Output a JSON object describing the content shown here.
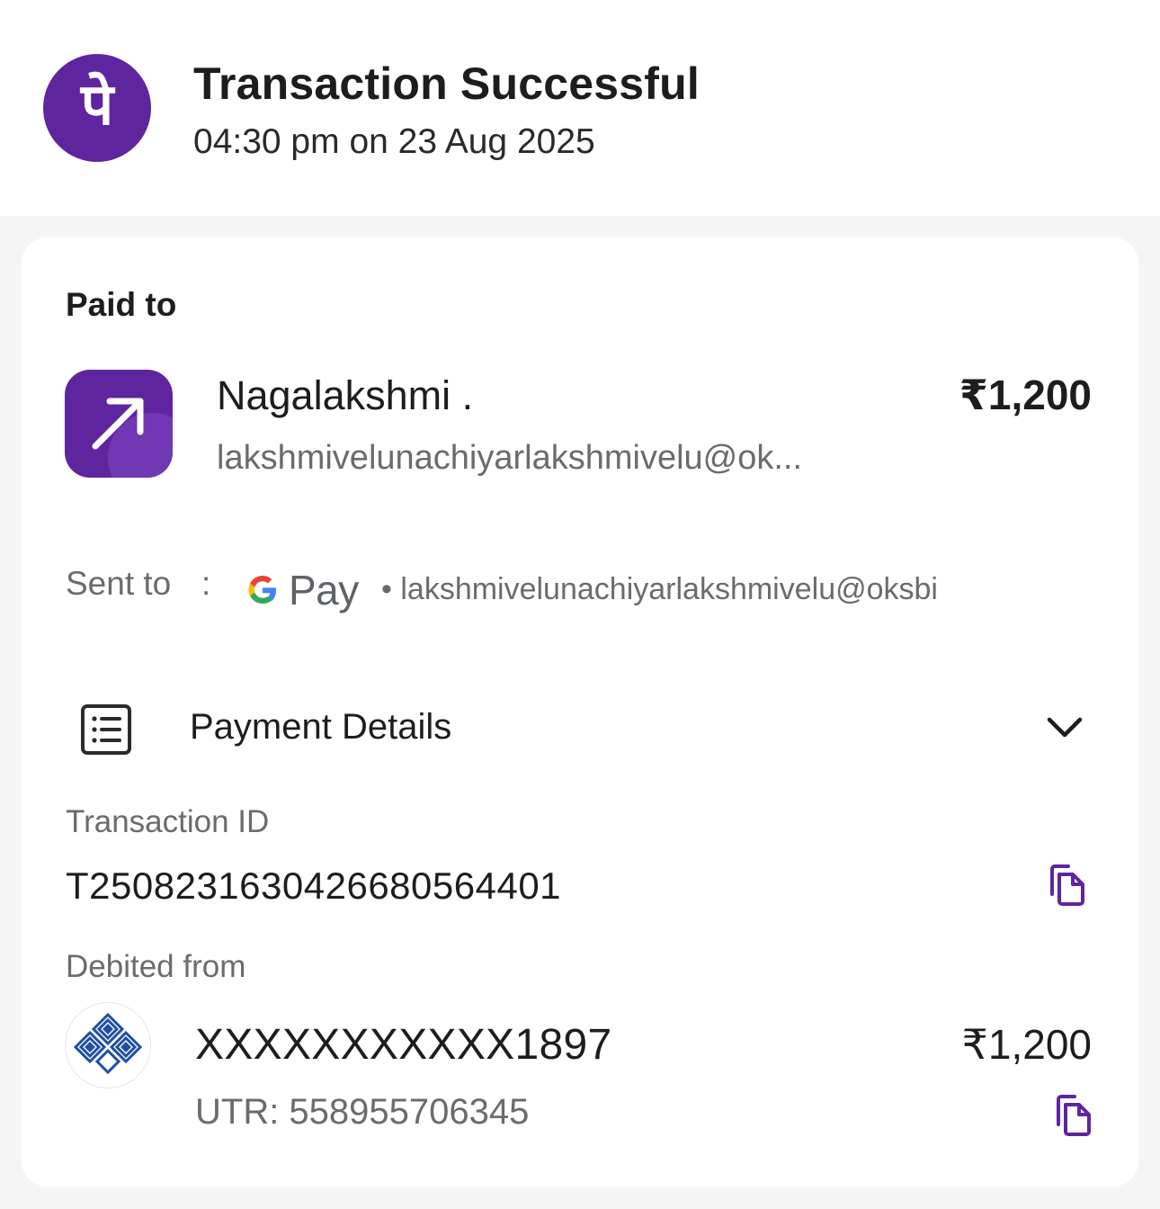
{
  "header": {
    "brand_icon": "phonepe-logo-icon",
    "brand_glyph": "पे",
    "title": "Transaction Successful",
    "timestamp": "04:30 pm on 23 Aug 2025"
  },
  "paid_to": {
    "label": "Paid to",
    "name": "Nagalakshmi  .",
    "amount": "₹1,200",
    "upi_id": "lakshmivelunachiyarlakshmivelu@ok...",
    "avatar_icon": "arrow-up-right-icon"
  },
  "sent_to": {
    "label": "Sent to",
    "separator": ":",
    "app_icon": "google-pay-logo-icon",
    "app_name": "Pay",
    "upi_id": "• lakshmivelunachiyarlakshmivelu@oksbi"
  },
  "payment_details": {
    "label": "Payment Details",
    "icon": "receipt-list-icon",
    "expand_icon": "chevron-down-icon",
    "transaction_id_label": "Transaction ID",
    "transaction_id": "T2508231630426680564401",
    "debited_from_label": "Debited from",
    "bank_icon": "bank-logo-icon",
    "account_number": "XXXXXXXXXXX1897",
    "debited_amount": "₹1,200",
    "utr": "UTR: 558955706345"
  },
  "colors": {
    "brand_purple": "#5f259f",
    "text_primary": "#1d1d1d",
    "text_secondary": "#6b6b6b",
    "bank_blue": "#1f4fa3"
  }
}
